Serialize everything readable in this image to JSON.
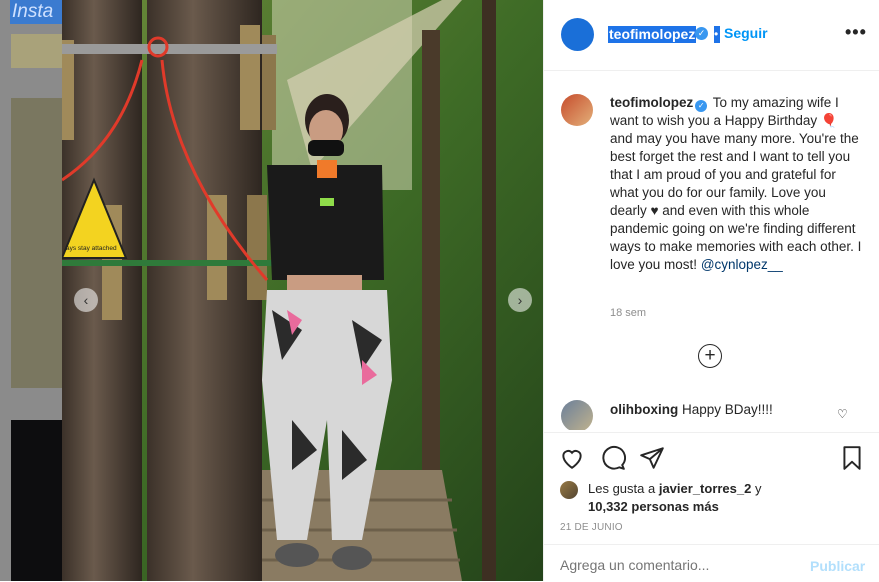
{
  "background": {
    "logo_text": "Insta"
  },
  "post": {
    "username": "teofimolopez",
    "follow_label": "Seguir",
    "more_icon": "more-options-icon",
    "caption_user": "teofimolopez",
    "caption_text": "To my amazing wife I want to wish you a Happy Birthday 🎈 and may you have many more. You're the best forget the rest and I want to tell you that I am proud of you and grateful for what you do for our family. Love you dearly ♥ and even with this whole pandemic going on we're finding different ways to make memories with each other. I love you most!",
    "caption_mention": "@cynlopez__",
    "caption_time": "18 sem",
    "load_more_icon": "plus-circle-icon",
    "comment": {
      "user": "olihboxing",
      "text": "Happy BDay!!!!"
    },
    "likes": {
      "prefix": "Les gusta a",
      "user": "javier_torres_2",
      "conj": "y",
      "count_text": "10,332 personas más"
    },
    "date": "21 DE JUNIO",
    "comment_placeholder": "Agrega un comentario...",
    "publish_label": "Publicar",
    "photo_sign_text": "ays stay attached"
  },
  "colors": {
    "accent": "#0095f6",
    "verified": "#3897f0",
    "username_highlight": "#1e73e8"
  }
}
